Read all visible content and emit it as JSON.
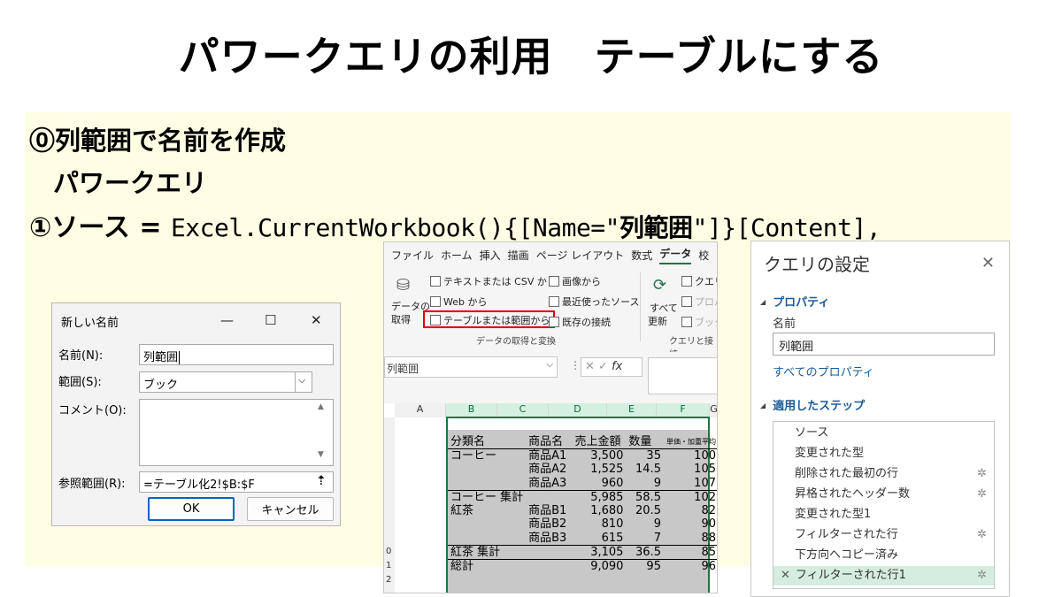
{
  "title": "パワークエリの利用　テーブルにする",
  "lines": {
    "l1": "⓪列範囲で名前を作成",
    "l2": "パワークエリ",
    "l3_prefix": "①ソース = ",
    "l3_code1": "Excel.CurrentWorkbook(){[Name=\"",
    "l3_bold": "列範囲",
    "l3_code2": "\"]}[Content],"
  },
  "dialog": {
    "title": "新しい名前",
    "name_label": "名前(N):",
    "name_value": "列範囲",
    "scope_label": "範囲(S):",
    "scope_value": "ブック",
    "comment_label": "コメント(O):",
    "refers_label": "参照範囲(R):",
    "refers_value": "=テーブル化2!$B:$F",
    "ok_label": "OK",
    "cancel_label": "キャンセル",
    "minimize": "—",
    "maximize": "☐",
    "close": "✕"
  },
  "excel": {
    "tabs": [
      "ファイル",
      "ホーム",
      "挿入",
      "描画",
      "ページ レイアウト",
      "数式",
      "データ",
      "校"
    ],
    "active_tab": "データ",
    "ribbon": {
      "get_data": "データの",
      "get_data2": "取得",
      "text_csv": "テキストまたは CSV から",
      "web": "Web から",
      "table_range": "テーブルまたは範囲から",
      "image": "画像から",
      "recent": "最近使ったソース",
      "existing": "既存の接続",
      "refresh": "すべて",
      "refresh2": "更新",
      "queries": "クエリ",
      "props": "プロパ",
      "links": "ブック",
      "group1": "データの取得と変換",
      "group2": "クエリと接続"
    },
    "name_box": "列範囲",
    "fx": "fx",
    "columns": [
      "A",
      "B",
      "C",
      "D",
      "E",
      "F",
      "G"
    ],
    "rows": [
      "",
      "",
      "",
      "",
      "",
      "",
      "",
      "",
      "",
      "0",
      "1",
      "2"
    ],
    "table_headers": [
      "分類名",
      "商品名",
      "売上金額",
      "数量",
      "単価・加重平均"
    ],
    "table_rows": [
      [
        "コーヒー",
        "商品A1",
        "3,500",
        "35",
        "100"
      ],
      [
        "",
        "商品A2",
        "1,525",
        "14.5",
        "105"
      ],
      [
        "",
        "商品A3",
        "960",
        "9",
        "107"
      ],
      [
        "コーヒー 集計",
        "",
        "5,985",
        "58.5",
        "102"
      ],
      [
        "紅茶",
        "商品B1",
        "1,680",
        "20.5",
        "82"
      ],
      [
        "",
        "商品B2",
        "810",
        "9",
        "90"
      ],
      [
        "",
        "商品B3",
        "615",
        "7",
        "88"
      ],
      [
        "紅茶 集計",
        "",
        "3,105",
        "36.5",
        "85"
      ],
      [
        "総計",
        "",
        "9,090",
        "95",
        "96"
      ]
    ]
  },
  "query_settings": {
    "title": "クエリの設定",
    "close": "✕",
    "properties": "プロパティ",
    "name_label": "名前",
    "name_value": "列範囲",
    "all_props": "すべてのプロパティ",
    "applied_steps": "適用したステップ",
    "steps": [
      {
        "label": "ソース",
        "gear": false
      },
      {
        "label": "変更された型",
        "gear": false
      },
      {
        "label": "削除された最初の行",
        "gear": true
      },
      {
        "label": "昇格されたヘッダー数",
        "gear": true
      },
      {
        "label": "変更された型1",
        "gear": false
      },
      {
        "label": "フィルターされた行",
        "gear": true
      },
      {
        "label": "下方向へコピー済み",
        "gear": false
      },
      {
        "label": "フィルターされた行1",
        "gear": true
      }
    ],
    "selected_mark": "✕",
    "gear_icon": "✲"
  }
}
